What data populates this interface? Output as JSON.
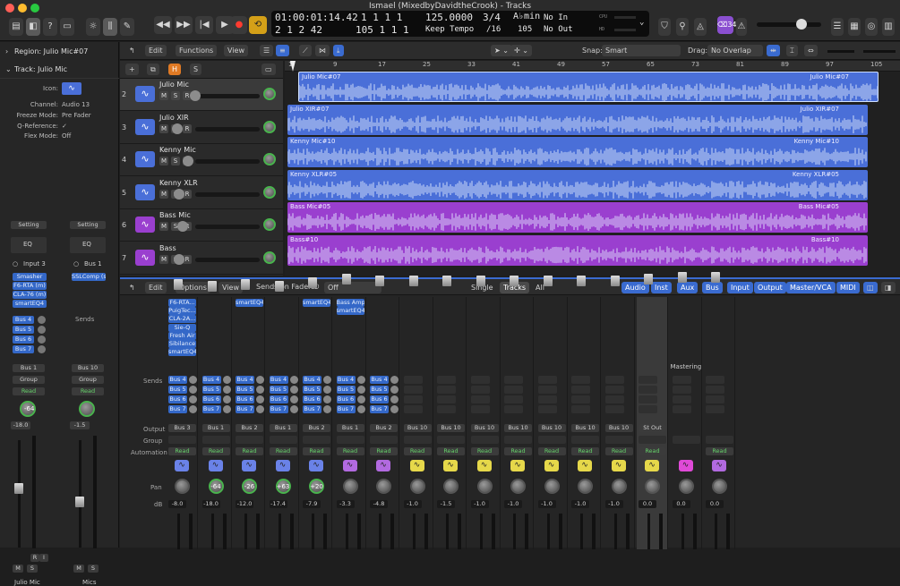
{
  "window": {
    "title": "Ismael (MixedbyDavidtheCrook) - Tracks"
  },
  "lcd": {
    "position_time": "01:00:01:14.42",
    "position_bars": "2 1 2 42",
    "bars_top": "1 1 1 1",
    "bars_bottom": "105 1 1 1",
    "tempo": "125.0000",
    "tempo_mode": "Keep Tempo",
    "signature": "3/4",
    "division": "/16",
    "key": "A♭min",
    "key_value": "105",
    "in_label": "No In",
    "out_label": "No Out",
    "cpu_label": "CPU",
    "hd_label": "HD"
  },
  "toolbar_right": {
    "counter": "⌫34"
  },
  "inspector": {
    "region_label": "Region: Julio Mic#07",
    "track_label": "Track: Julio Mic",
    "rows": [
      {
        "k": "Icon:",
        "v": ""
      },
      {
        "k": "Channel:",
        "v": "Audio 13"
      },
      {
        "k": "Freeze Mode:",
        "v": "Pre Fader"
      },
      {
        "k": "Q-Reference:",
        "v": "✓"
      },
      {
        "k": "Flex Mode:",
        "v": "Off"
      }
    ],
    "left_strip": {
      "setting": "Setting",
      "eq": "EQ",
      "input": "Input 3",
      "plugins": [
        "Smasher",
        "F6-RTA (m)",
        "CLA-76 (m)",
        "smartEQ4"
      ],
      "sends": [
        "Bus 4",
        "Bus 5",
        "Bus 6",
        "Bus 7"
      ],
      "output": "Bus 1",
      "group": "Group",
      "automation": "Read",
      "pan": "-64",
      "db": "-18.0",
      "m": "M",
      "s": "S",
      "r": "R",
      "i": "I",
      "name": "Julio Mic"
    },
    "right_strip": {
      "setting": "Setting",
      "eq": "EQ",
      "input": "Bus 1",
      "plugins": [
        "SSLComp (s"
      ],
      "sends_label": "Sends",
      "output": "Bus 10",
      "group": "Group",
      "automation": "Read",
      "db": "-1.5",
      "m": "M",
      "s": "S",
      "name": "Mics"
    }
  },
  "arrange_toolbar": {
    "edit": "Edit",
    "functions": "Functions",
    "view": "View",
    "snap_label": "Snap:",
    "snap_value": "Smart",
    "drag_label": "Drag:",
    "drag_value": "No Overlap"
  },
  "track_header_buttons": {
    "add": "+",
    "h": "H",
    "s": "S"
  },
  "ruler": [
    "1",
    "9",
    "17",
    "25",
    "33",
    "41",
    "49",
    "57",
    "65",
    "73",
    "81",
    "89",
    "97",
    "105"
  ],
  "tracks": [
    {
      "num": "2",
      "name": "Julio Mic",
      "color": "#4a6fd8",
      "region": "Julio Mic#07",
      "selected": true
    },
    {
      "num": "3",
      "name": "Julio XIR",
      "color": "#4a6fd8",
      "region": "Julio XIR#07"
    },
    {
      "num": "4",
      "name": "Kenny Mic",
      "color": "#4a6fd8",
      "region": "Kenny Mic#10"
    },
    {
      "num": "5",
      "name": "Kenny XLR",
      "color": "#4a6fd8",
      "region": "Kenny XLR#05"
    },
    {
      "num": "6",
      "name": "Bass Mic",
      "color": "#9a3fcf",
      "region": "Bass Mic#05"
    },
    {
      "num": "7",
      "name": "Bass",
      "color": "#9a3fcf",
      "region": "Bass#10"
    }
  ],
  "mixer_toolbar": {
    "edit": "Edit",
    "options": "Options",
    "view": "View",
    "sends_on_faders": "Sends on Faders:",
    "sends_value": "Off",
    "tabs": [
      "Single",
      "Tracks",
      "All"
    ],
    "filters": [
      "Audio",
      "Inst",
      "Aux",
      "Bus",
      "Input",
      "Output",
      "Master/VCA",
      "MIDI"
    ]
  },
  "mixer_labels": {
    "sends": "Sends",
    "output": "Output",
    "group": "Group",
    "automation": "Automation",
    "pan": "Pan",
    "db": "dB",
    "mastering": "Mastering"
  },
  "mixer_strips": [
    {
      "plugins": [
        "F6-RTA...",
        "PuigTec...",
        "CLA-2A...",
        "Sie-Q",
        "Fresh Air",
        "Sibilance",
        "smartEQ4"
      ],
      "sends": [
        "Bus 4",
        "Bus 5",
        "Bus 6",
        "Bus 7"
      ],
      "output": "Bus 3",
      "auto": "Read",
      "pan": "",
      "db": "-8.0",
      "color": "#6a82e8"
    },
    {
      "plugins": [],
      "sends": [
        "Bus 4",
        "Bus 5",
        "Bus 6",
        "Bus 7"
      ],
      "output": "Bus 1",
      "auto": "Read",
      "pan": "-64",
      "db": "-18.0",
      "color": "#6a82e8"
    },
    {
      "plugins": [
        "smartEQ4"
      ],
      "sends": [
        "Bus 4",
        "Bus 5",
        "Bus 6",
        "Bus 7"
      ],
      "output": "Bus 2",
      "auto": "Read",
      "pan": "-26",
      "db": "-12.0",
      "color": "#6a82e8"
    },
    {
      "plugins": [],
      "sends": [
        "Bus 4",
        "Bus 5",
        "Bus 6",
        "Bus 7"
      ],
      "output": "Bus 1",
      "auto": "Read",
      "pan": "+63",
      "db": "-17.4",
      "color": "#6a82e8"
    },
    {
      "plugins": [
        "smartEQ4"
      ],
      "sends": [
        "Bus 4",
        "Bus 5",
        "Bus 6",
        "Bus 7"
      ],
      "output": "Bus 2",
      "auto": "Read",
      "pan": "+20",
      "db": "-7.9",
      "color": "#6a82e8"
    },
    {
      "plugins": [
        "Bass Amp",
        "smartEQ4"
      ],
      "sends": [
        "Bus 4",
        "Bus 5",
        "Bus 6",
        "Bus 7"
      ],
      "output": "Bus 1",
      "auto": "Read",
      "pan": "",
      "db": "-3.3",
      "color": "#b26ae0"
    },
    {
      "plugins": [],
      "sends": [
        "Bus 4",
        "Bus 5",
        "Bus 6",
        "Bus 7"
      ],
      "output": "Bus 2",
      "auto": "Read",
      "pan": "",
      "db": "-4.8",
      "color": "#b26ae0"
    },
    {
      "plugins": [],
      "sends": [],
      "output": "Bus 10",
      "auto": "Read",
      "pan": "",
      "db": "-1.0",
      "color": "#e6d84a"
    },
    {
      "plugins": [],
      "sends": [],
      "output": "Bus 10",
      "auto": "Read",
      "pan": "",
      "db": "-1.5",
      "color": "#e6d84a"
    },
    {
      "plugins": [],
      "sends": [],
      "output": "Bus 10",
      "auto": "Read",
      "pan": "",
      "db": "-1.0",
      "color": "#e6d84a"
    },
    {
      "plugins": [],
      "sends": [],
      "output": "Bus 10",
      "auto": "Read",
      "pan": "",
      "db": "-1.0",
      "color": "#e6d84a"
    },
    {
      "plugins": [],
      "sends": [],
      "output": "Bus 10",
      "auto": "Read",
      "pan": "",
      "db": "-1.0",
      "color": "#e6d84a"
    },
    {
      "plugins": [],
      "sends": [],
      "output": "Bus 10",
      "auto": "Read",
      "pan": "",
      "db": "-1.0",
      "color": "#e6d84a"
    },
    {
      "plugins": [],
      "sends": [],
      "output": "Bus 10",
      "auto": "Read",
      "pan": "",
      "db": "-1.0",
      "color": "#e6d84a"
    },
    {
      "plugins": [],
      "sends": [],
      "output": "St Out",
      "auto": "Read",
      "pan": "",
      "db": "0.0",
      "color": "#e6d84a"
    },
    {
      "plugins": [],
      "sends": [],
      "output": "",
      "auto": "",
      "pan": "",
      "db": "0.0",
      "color": "#e04ad8",
      "label": "Mastering"
    },
    {
      "plugins": [],
      "sends": [],
      "output": "",
      "auto": "Read",
      "pan": "",
      "db": "0.0",
      "color": "#b26ae0"
    }
  ]
}
